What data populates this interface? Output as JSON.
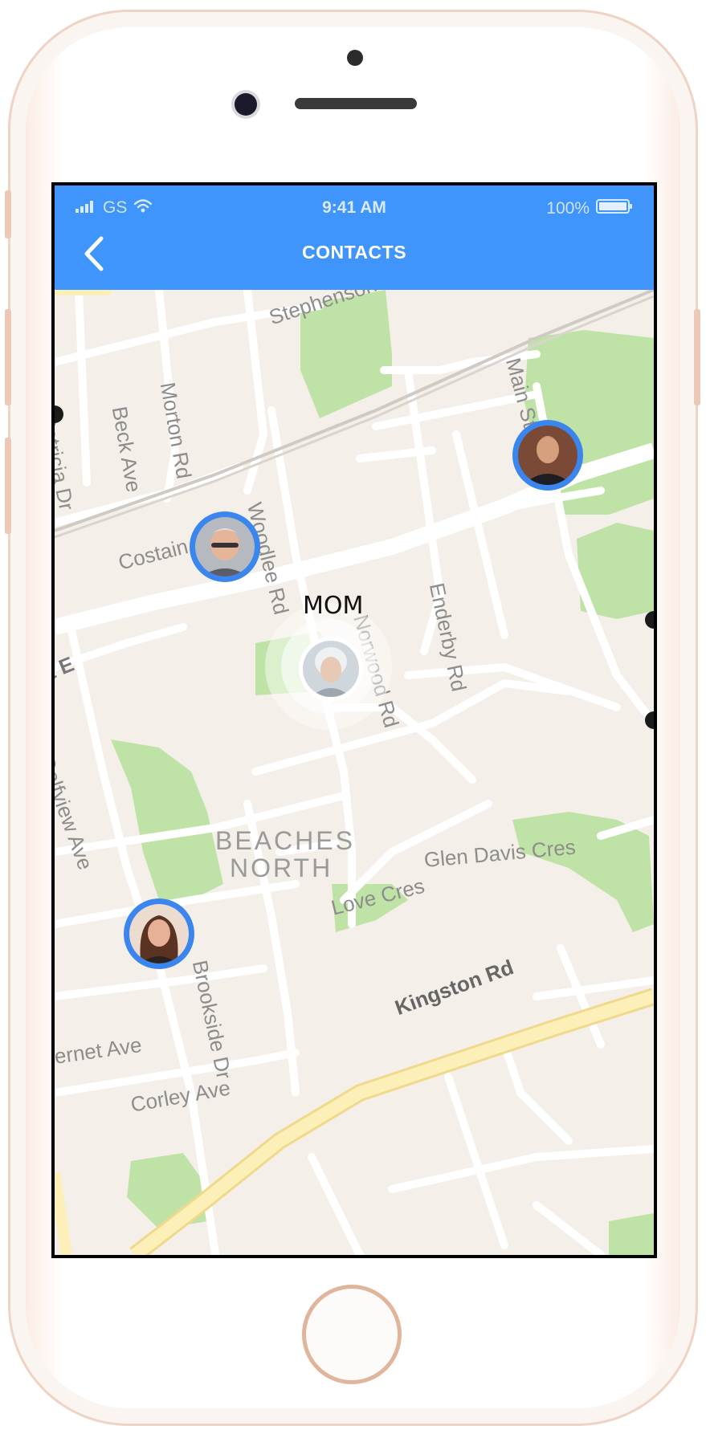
{
  "status_bar": {
    "carrier": "GS",
    "time": "9:41 AM",
    "battery": "100%"
  },
  "header": {
    "title": "CONTACTS"
  },
  "map": {
    "streets": [
      "Stephenson",
      "Main St",
      "Patricia Dr",
      "Beck Ave",
      "Morton Rd",
      "Ave",
      "Woodlee Rd",
      "Costain Ave",
      "Norwood Rd",
      "Enderby Rd",
      "t E",
      "Golfview Ave",
      "Glen Davis Cres",
      "Love Cres",
      "Brookside Dr",
      "Kingston Rd",
      "ernet Ave",
      "Corley Ave"
    ],
    "neighborhood": [
      "BEACHES",
      "NORTH"
    ]
  },
  "contacts": [
    {
      "name": "MOM",
      "highlighted": true
    },
    {
      "name": "",
      "highlighted": false
    },
    {
      "name": "",
      "highlighted": false
    },
    {
      "name": "",
      "highlighted": false
    }
  ],
  "colors": {
    "accent": "#3f95fb",
    "pin_ring": "#3a86ee",
    "map_background": "#f4efe8",
    "park": "#bfe3a6",
    "road_major": "#fbe9a8"
  }
}
